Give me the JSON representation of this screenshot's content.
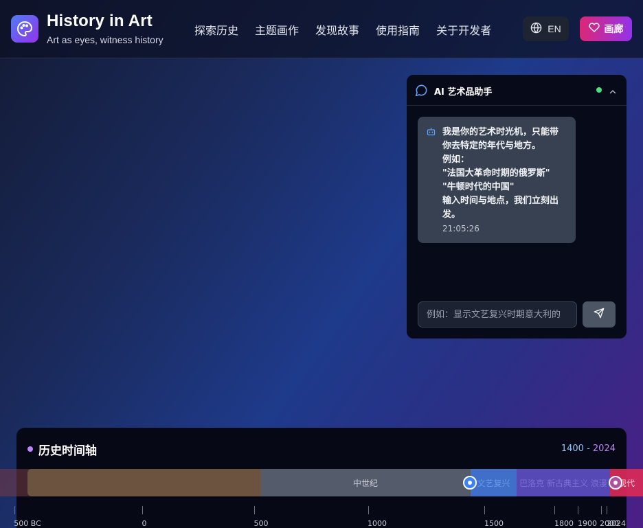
{
  "header": {
    "title": "History in Art",
    "subtitle": "Art as eyes, witness history",
    "nav": [
      "探索历史",
      "主题画作",
      "发现故事",
      "使用指南",
      "关于开发者"
    ],
    "lang_label": "EN",
    "gallery_label": "画廊"
  },
  "chat": {
    "title": "AI 艺术品助手",
    "status": "online",
    "message_lines": [
      "我是你的艺术时光机，只能带",
      "你去特定的年代与地方。",
      "例如：",
      "\"法国大革命时期的俄罗斯\"",
      "\"牛顿时代的中国\"",
      "输入时间与地点，我们立刻出",
      "发。"
    ],
    "message_time": "21:05:26",
    "input_placeholder": "例如：显示文艺复兴时期意大利的"
  },
  "timeline": {
    "title": "历史时间轴",
    "range_from": "1400",
    "range_sep": " - ",
    "range_to": "2024",
    "periods": [
      {
        "label": ""
      },
      {
        "label": "中世纪"
      },
      {
        "label": "文艺复兴"
      },
      {
        "label": "巴洛克 新古典主义 浪漫"
      },
      {
        "label": "现代"
      }
    ],
    "ticks": [
      "500 BC",
      "0",
      "500",
      "1000",
      "1500",
      "1800",
      "1900",
      "2000",
      "2024"
    ]
  },
  "colors": {
    "accent_blue": "#3b82f6",
    "accent_purple": "#9333ea",
    "accent_pink": "#db2777",
    "online": "#4ade80"
  }
}
